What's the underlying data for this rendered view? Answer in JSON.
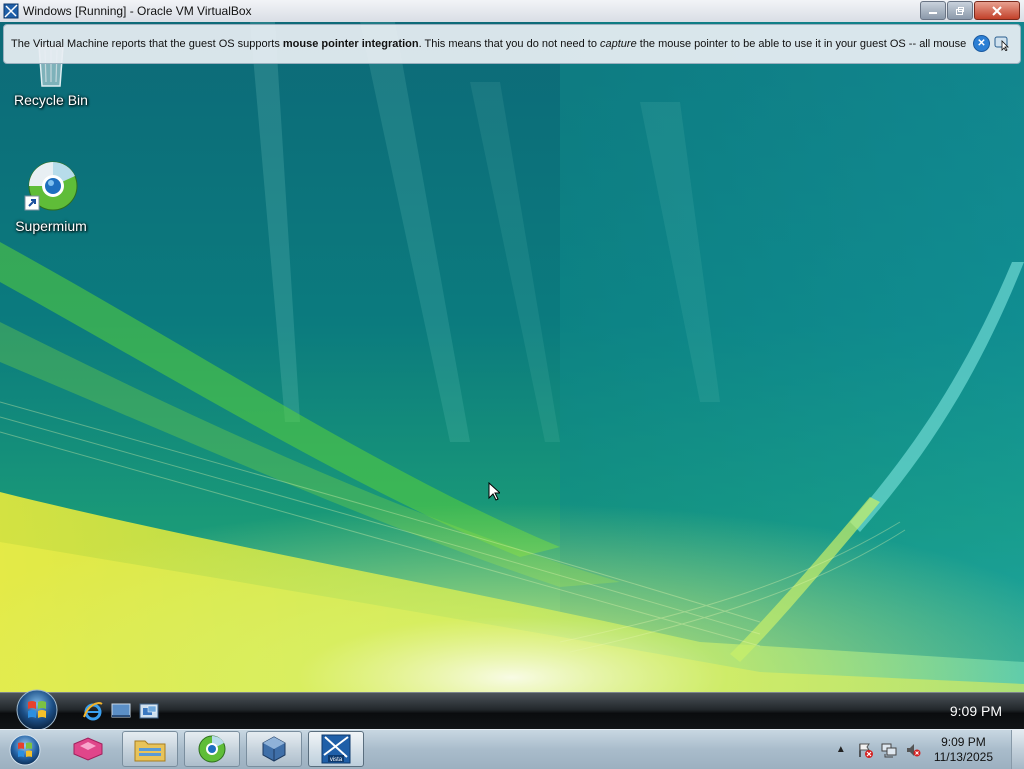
{
  "window": {
    "title": "Windows [Running] - Oracle VM VirtualBox",
    "controls": [
      "minimize-icon",
      "restore-icon",
      "close-icon"
    ]
  },
  "notification": {
    "text_part1": "The Virtual Machine reports that the guest OS supports ",
    "text_bold": "mouse pointer integration",
    "text_part2": ". This means that you do not need to ",
    "text_italic": "capture",
    "text_part3": " the mouse pointer to be able to use it in your guest OS -- all mouse",
    "close_glyph": "✕"
  },
  "desktop": {
    "icons": [
      {
        "label": "Recycle Bin",
        "icon": "recycle-bin-icon"
      },
      {
        "label": "Supermium",
        "icon": "supermium-icon"
      }
    ]
  },
  "guest_taskbar": {
    "clock": "9:09 PM",
    "quick_launch": [
      "internet-explorer-icon",
      "show-desktop-icon",
      "switch-windows-icon"
    ]
  },
  "host_taskbar": {
    "pinned": [
      "xbox-app-icon",
      "file-explorer-icon",
      "supermium-icon",
      "virtualbox-icon",
      "vista-vm-icon"
    ],
    "tray": {
      "arrow": "▲",
      "icons": [
        "action-center-flag-icon",
        "network-icon",
        "volume-muted-icon"
      ]
    },
    "time": "9:09 PM",
    "date": "11/13/2025"
  },
  "colors": {
    "accent": "#2c7fd4",
    "wallpaper_teal": "#0b6f79",
    "wallpaper_green": "#56c23a",
    "wallpaper_yellow": "#e5e53a"
  }
}
